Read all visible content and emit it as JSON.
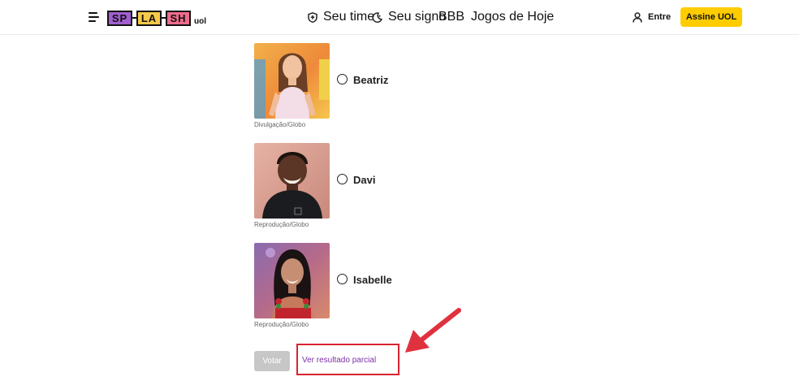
{
  "header": {
    "logo": {
      "letters": [
        "SP",
        "LA",
        "SH"
      ],
      "suffix": "uol",
      "colors": [
        "#a25fd0",
        "#f7c948",
        "#ef6b8c"
      ]
    },
    "nav": [
      {
        "label": "Seu time",
        "icon": "shield-icon"
      },
      {
        "label": "Seu signo",
        "icon": "moon-icon"
      },
      {
        "label": "BBB",
        "icon": ""
      },
      {
        "label": "Jogos de Hoje",
        "icon": ""
      }
    ],
    "login_label": "Entre",
    "subscribe_label": "Assine UOL",
    "accent": "#ffcc00"
  },
  "poll": {
    "options": [
      {
        "name": "Beatriz",
        "credit": "Divulgação/Globo",
        "selected": false
      },
      {
        "name": "Davi",
        "credit": "Reprodução/Globo",
        "selected": false
      },
      {
        "name": "Isabelle",
        "credit": "Reprodução/Globo",
        "selected": false
      }
    ],
    "vote_label": "Votar",
    "partial_label": "Ver resultado parcial",
    "link_color": "#7d2fa8",
    "annotation_color": "#d82430"
  }
}
